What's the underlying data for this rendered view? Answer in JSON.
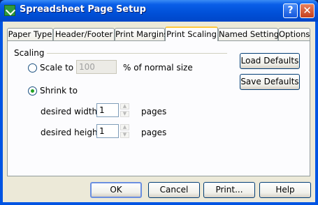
{
  "window": {
    "title": "Spreadsheet Page Setup",
    "help_glyph": "?",
    "close_glyph": "✕"
  },
  "tabs": [
    {
      "label": "Paper Type"
    },
    {
      "label": "Header/Footer"
    },
    {
      "label": "Print Margins"
    },
    {
      "label": "Print Scaling",
      "active": true
    },
    {
      "label": "Named Settings"
    },
    {
      "label": "Options"
    }
  ],
  "scaling": {
    "group_label": "Scaling",
    "scale_to_label": "Scale to",
    "scale_value": "100",
    "scale_suffix": "% of normal size",
    "shrink_to_label": "Shrink to",
    "width_label": "desired width:",
    "width_value": "1",
    "width_suffix": "pages",
    "height_label": "desired height:",
    "height_value": "1",
    "height_suffix": "pages",
    "selected": "Shrink to"
  },
  "side_buttons": {
    "load": "Load Defaults",
    "save": "Save Defaults"
  },
  "footer": {
    "ok": "OK",
    "cancel": "Cancel",
    "print": "Print...",
    "help": "Help"
  }
}
